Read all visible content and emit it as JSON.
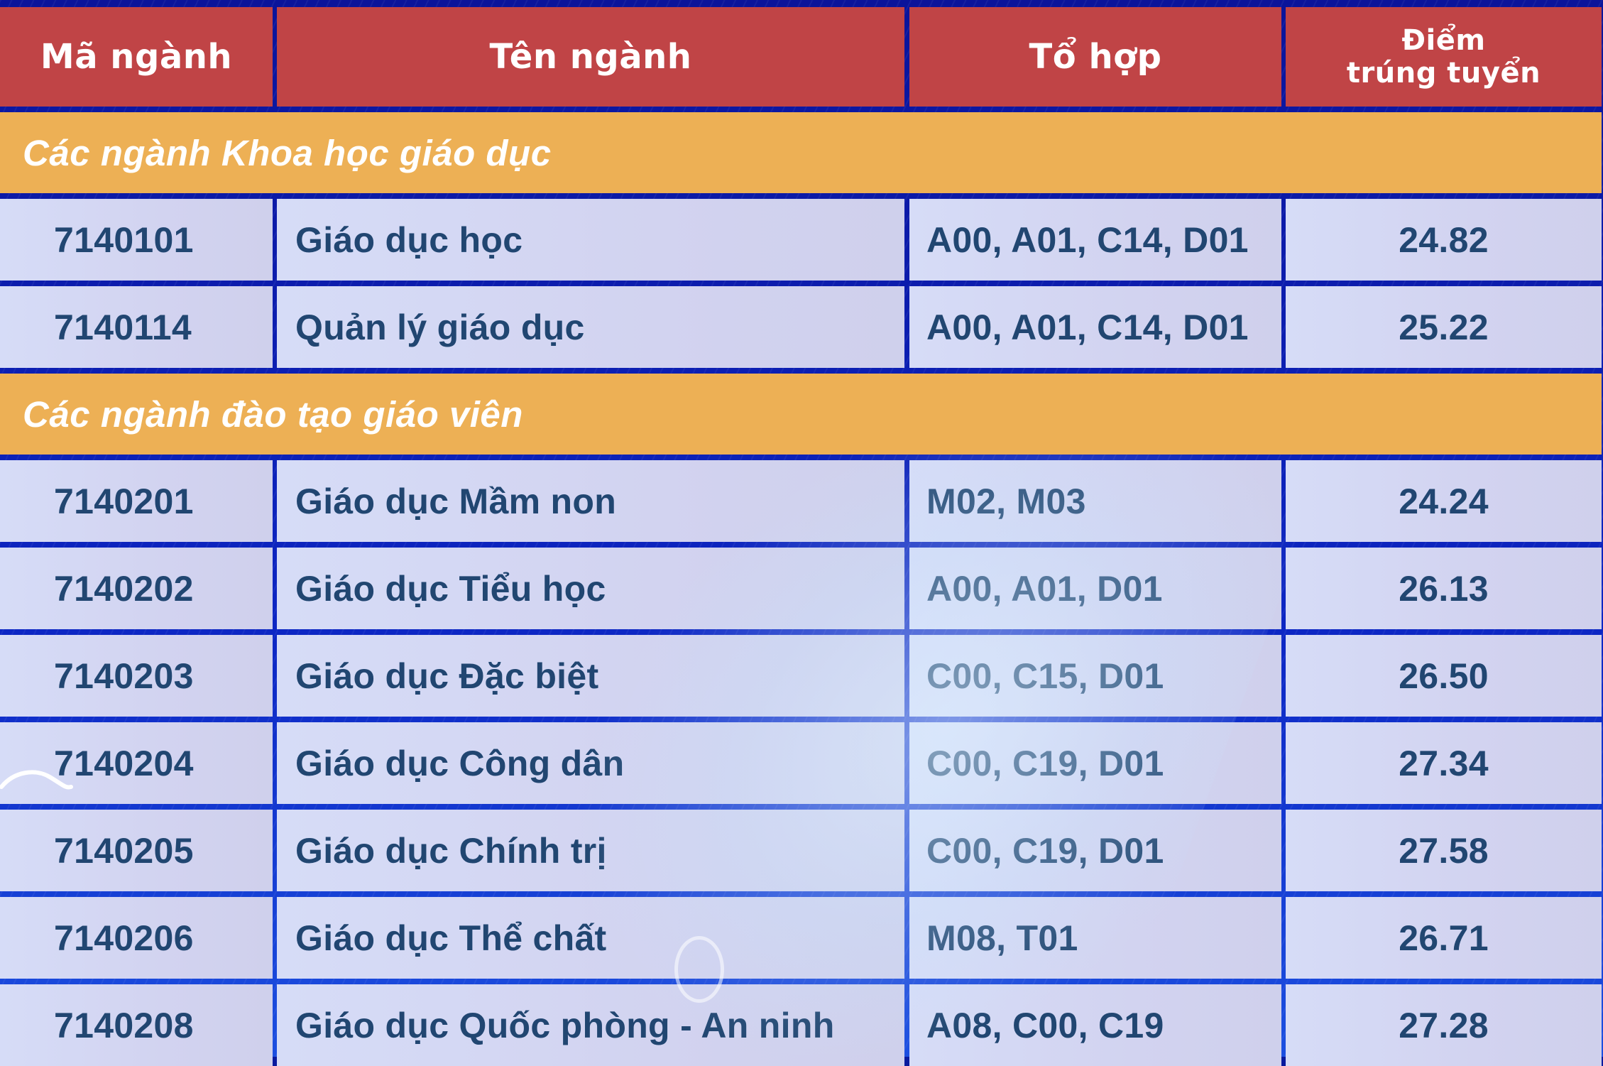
{
  "table": {
    "headers": {
      "code": "Mã ngành",
      "name": "Tên ngành",
      "combo": "Tổ hợp",
      "score_line1": "Điểm",
      "score_line2": "trúng tuyển"
    },
    "groups": [
      {
        "title": "Các ngành Khoa học giáo dục",
        "rows": [
          {
            "code": "7140101",
            "name": "Giáo dục học",
            "combo": "A00, A01, C14, D01",
            "score": "24.82"
          },
          {
            "code": "7140114",
            "name": "Quản lý giáo dục",
            "combo": "A00, A01, C14, D01",
            "score": "25.22"
          }
        ]
      },
      {
        "title": "Các ngành đào tạo giáo viên",
        "rows": [
          {
            "code": "7140201",
            "name": "Giáo dục Mầm non",
            "combo": "M02, M03",
            "score": "24.24"
          },
          {
            "code": "7140202",
            "name": "Giáo dục Tiểu học",
            "combo": "A00, A01, D01",
            "score": "26.13"
          },
          {
            "code": "7140203",
            "name": "Giáo dục Đặc biệt",
            "combo": "C00, C15, D01",
            "score": "26.50"
          },
          {
            "code": "7140204",
            "name": "Giáo dục Công dân",
            "combo": "C00, C19, D01",
            "score": "27.34"
          },
          {
            "code": "7140205",
            "name": "Giáo dục Chính trị",
            "combo": "C00, C19, D01",
            "score": "27.58"
          },
          {
            "code": "7140206",
            "name": "Giáo dục Thể chất",
            "combo": "M08, T01",
            "score": "26.71"
          },
          {
            "code": "7140208",
            "name": "Giáo dục Quốc phòng - An ninh",
            "combo": "A08, C00, C19",
            "score": "27.28"
          }
        ]
      }
    ]
  },
  "colors": {
    "header_bg": "#c04446",
    "group_bg": "#edb055",
    "grid_line": "#0b149a",
    "cell_bg": "#d4d8f4",
    "cell_text": "#214671"
  }
}
